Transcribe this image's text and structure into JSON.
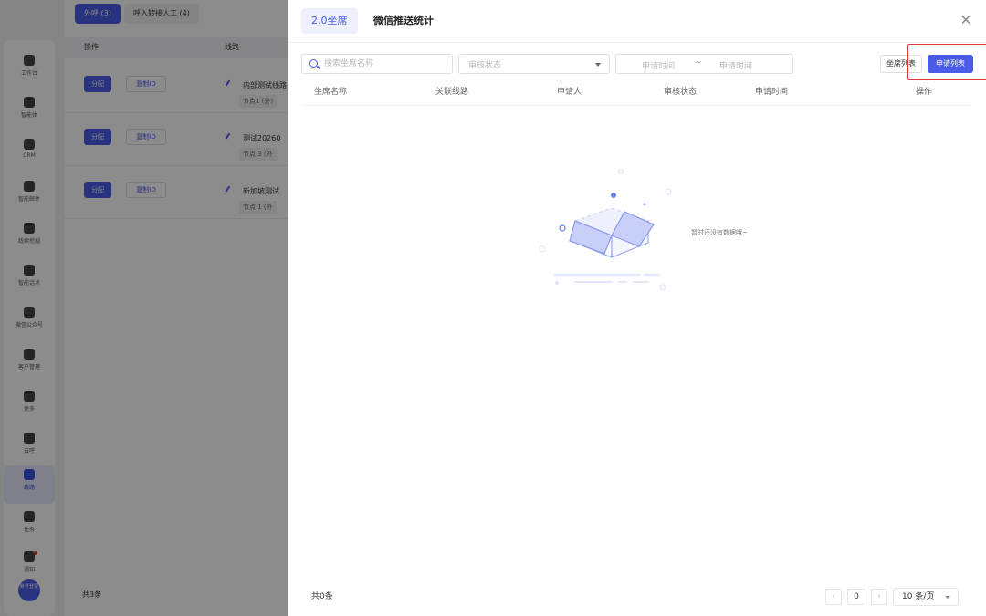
{
  "background": {
    "sidebar": [
      {
        "label": "工作台"
      },
      {
        "label": "智能体"
      },
      {
        "label": "CRM"
      },
      {
        "label": "智能邮件"
      },
      {
        "label": "线索挖掘"
      },
      {
        "label": "智能话术"
      },
      {
        "label": "微信公众号"
      },
      {
        "label": "客户管理"
      },
      {
        "label": "更多"
      },
      {
        "label": "云呼"
      },
      {
        "label": "线路"
      },
      {
        "label": "任务"
      },
      {
        "label": "通知"
      }
    ],
    "avatar_text": "账号登录",
    "tabs": [
      {
        "label": "外呼 (3)"
      },
      {
        "label": "呼入转接人工 (4)"
      }
    ],
    "columns": [
      "操作",
      "线路"
    ],
    "rows": [
      {
        "assign": "分配",
        "copy": "复制ID",
        "name": "内部测试线路",
        "tag": "节点1 (外)"
      },
      {
        "assign": "分配",
        "copy": "复制ID",
        "name": "测试20260",
        "tag": "节点 3 (外"
      },
      {
        "assign": "分配",
        "copy": "复制ID",
        "name": "新加坡测试",
        "tag": "节点 1 (外"
      }
    ],
    "total": "共3条"
  },
  "drawer": {
    "tabs": [
      {
        "label": "2.0坐席",
        "active": true
      },
      {
        "label": "微信推送统计",
        "active": false
      }
    ],
    "close_icon": "close-icon",
    "filters": {
      "search_placeholder": "搜索坐席名称",
      "status_placeholder": "审核状态",
      "date_start_placeholder": "申请时间",
      "date_separator": "~",
      "date_end_placeholder": "申请时间"
    },
    "buttons": {
      "seat_list": "坐席列表",
      "apply_list": "申请列表"
    },
    "table": {
      "columns": [
        "坐席名称",
        "关联线路",
        "申请人",
        "审核状态",
        "申请时间",
        "操作"
      ]
    },
    "empty_text": "暂时还没有数据哦~",
    "pagination": {
      "total": "共0条",
      "current_page": "0",
      "page_size": "10 条/页",
      "prev": "‹",
      "next": "›"
    }
  },
  "colors": {
    "accent": "#4a5be8",
    "highlight": "#e53935"
  }
}
